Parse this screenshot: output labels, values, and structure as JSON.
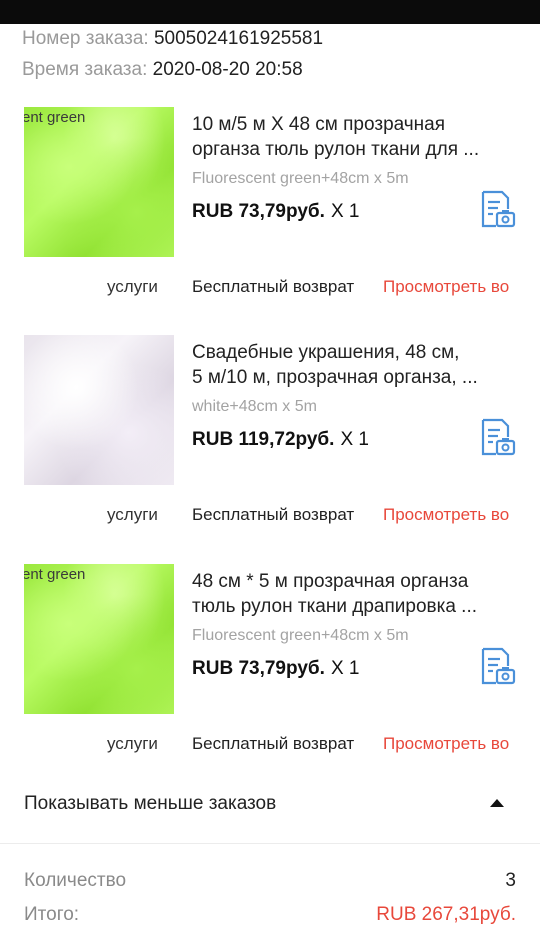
{
  "order": {
    "number_label": "Номер заказа:",
    "number_value": "5005024161925581",
    "time_label": "Время заказа:",
    "time_value": "2020-08-20 20:58"
  },
  "items": [
    {
      "thumb_label": "ent green",
      "title_line1": "10 м/5 м X 48 см прозрачная",
      "title_line2": "органза тюль рулон ткани для ...",
      "variant": "Fluorescent green+48cm x 5m",
      "price": "RUB 73,79руб.",
      "qty": "X 1",
      "services_label": "услуги",
      "free_return": "Бесплатный возврат",
      "view_link": "Просмотреть во"
    },
    {
      "thumb_label": "",
      "title_line1": "Свадебные украшения, 48 см,",
      "title_line2": "5 м/10 м, прозрачная органза, ...",
      "variant": "white+48cm x 5m",
      "price": "RUB 119,72руб.",
      "qty": "X 1",
      "services_label": "услуги",
      "free_return": "Бесплатный возврат",
      "view_link": "Просмотреть во"
    },
    {
      "thumb_label": "ent green",
      "title_line1": "48 см * 5 м прозрачная органза",
      "title_line2": "тюль рулон ткани драпировка ...",
      "variant": "Fluorescent green+48cm x 5m",
      "price": "RUB 73,79руб.",
      "qty": "X 1",
      "services_label": "услуги",
      "free_return": "Бесплатный возврат",
      "view_link": "Просмотреть во"
    }
  ],
  "show_fewer": "Показывать меньше заказов",
  "summary": {
    "quantity_label": "Количество",
    "quantity_value": "3",
    "total_label": "Итого:",
    "total_value": "RUB 267,31руб."
  },
  "colors": {
    "accent_red": "#e8483b",
    "icon_blue": "#4a90d9"
  },
  "icons": {
    "snapshot": "order-snapshot-icon",
    "collapse": "caret-up-icon"
  }
}
